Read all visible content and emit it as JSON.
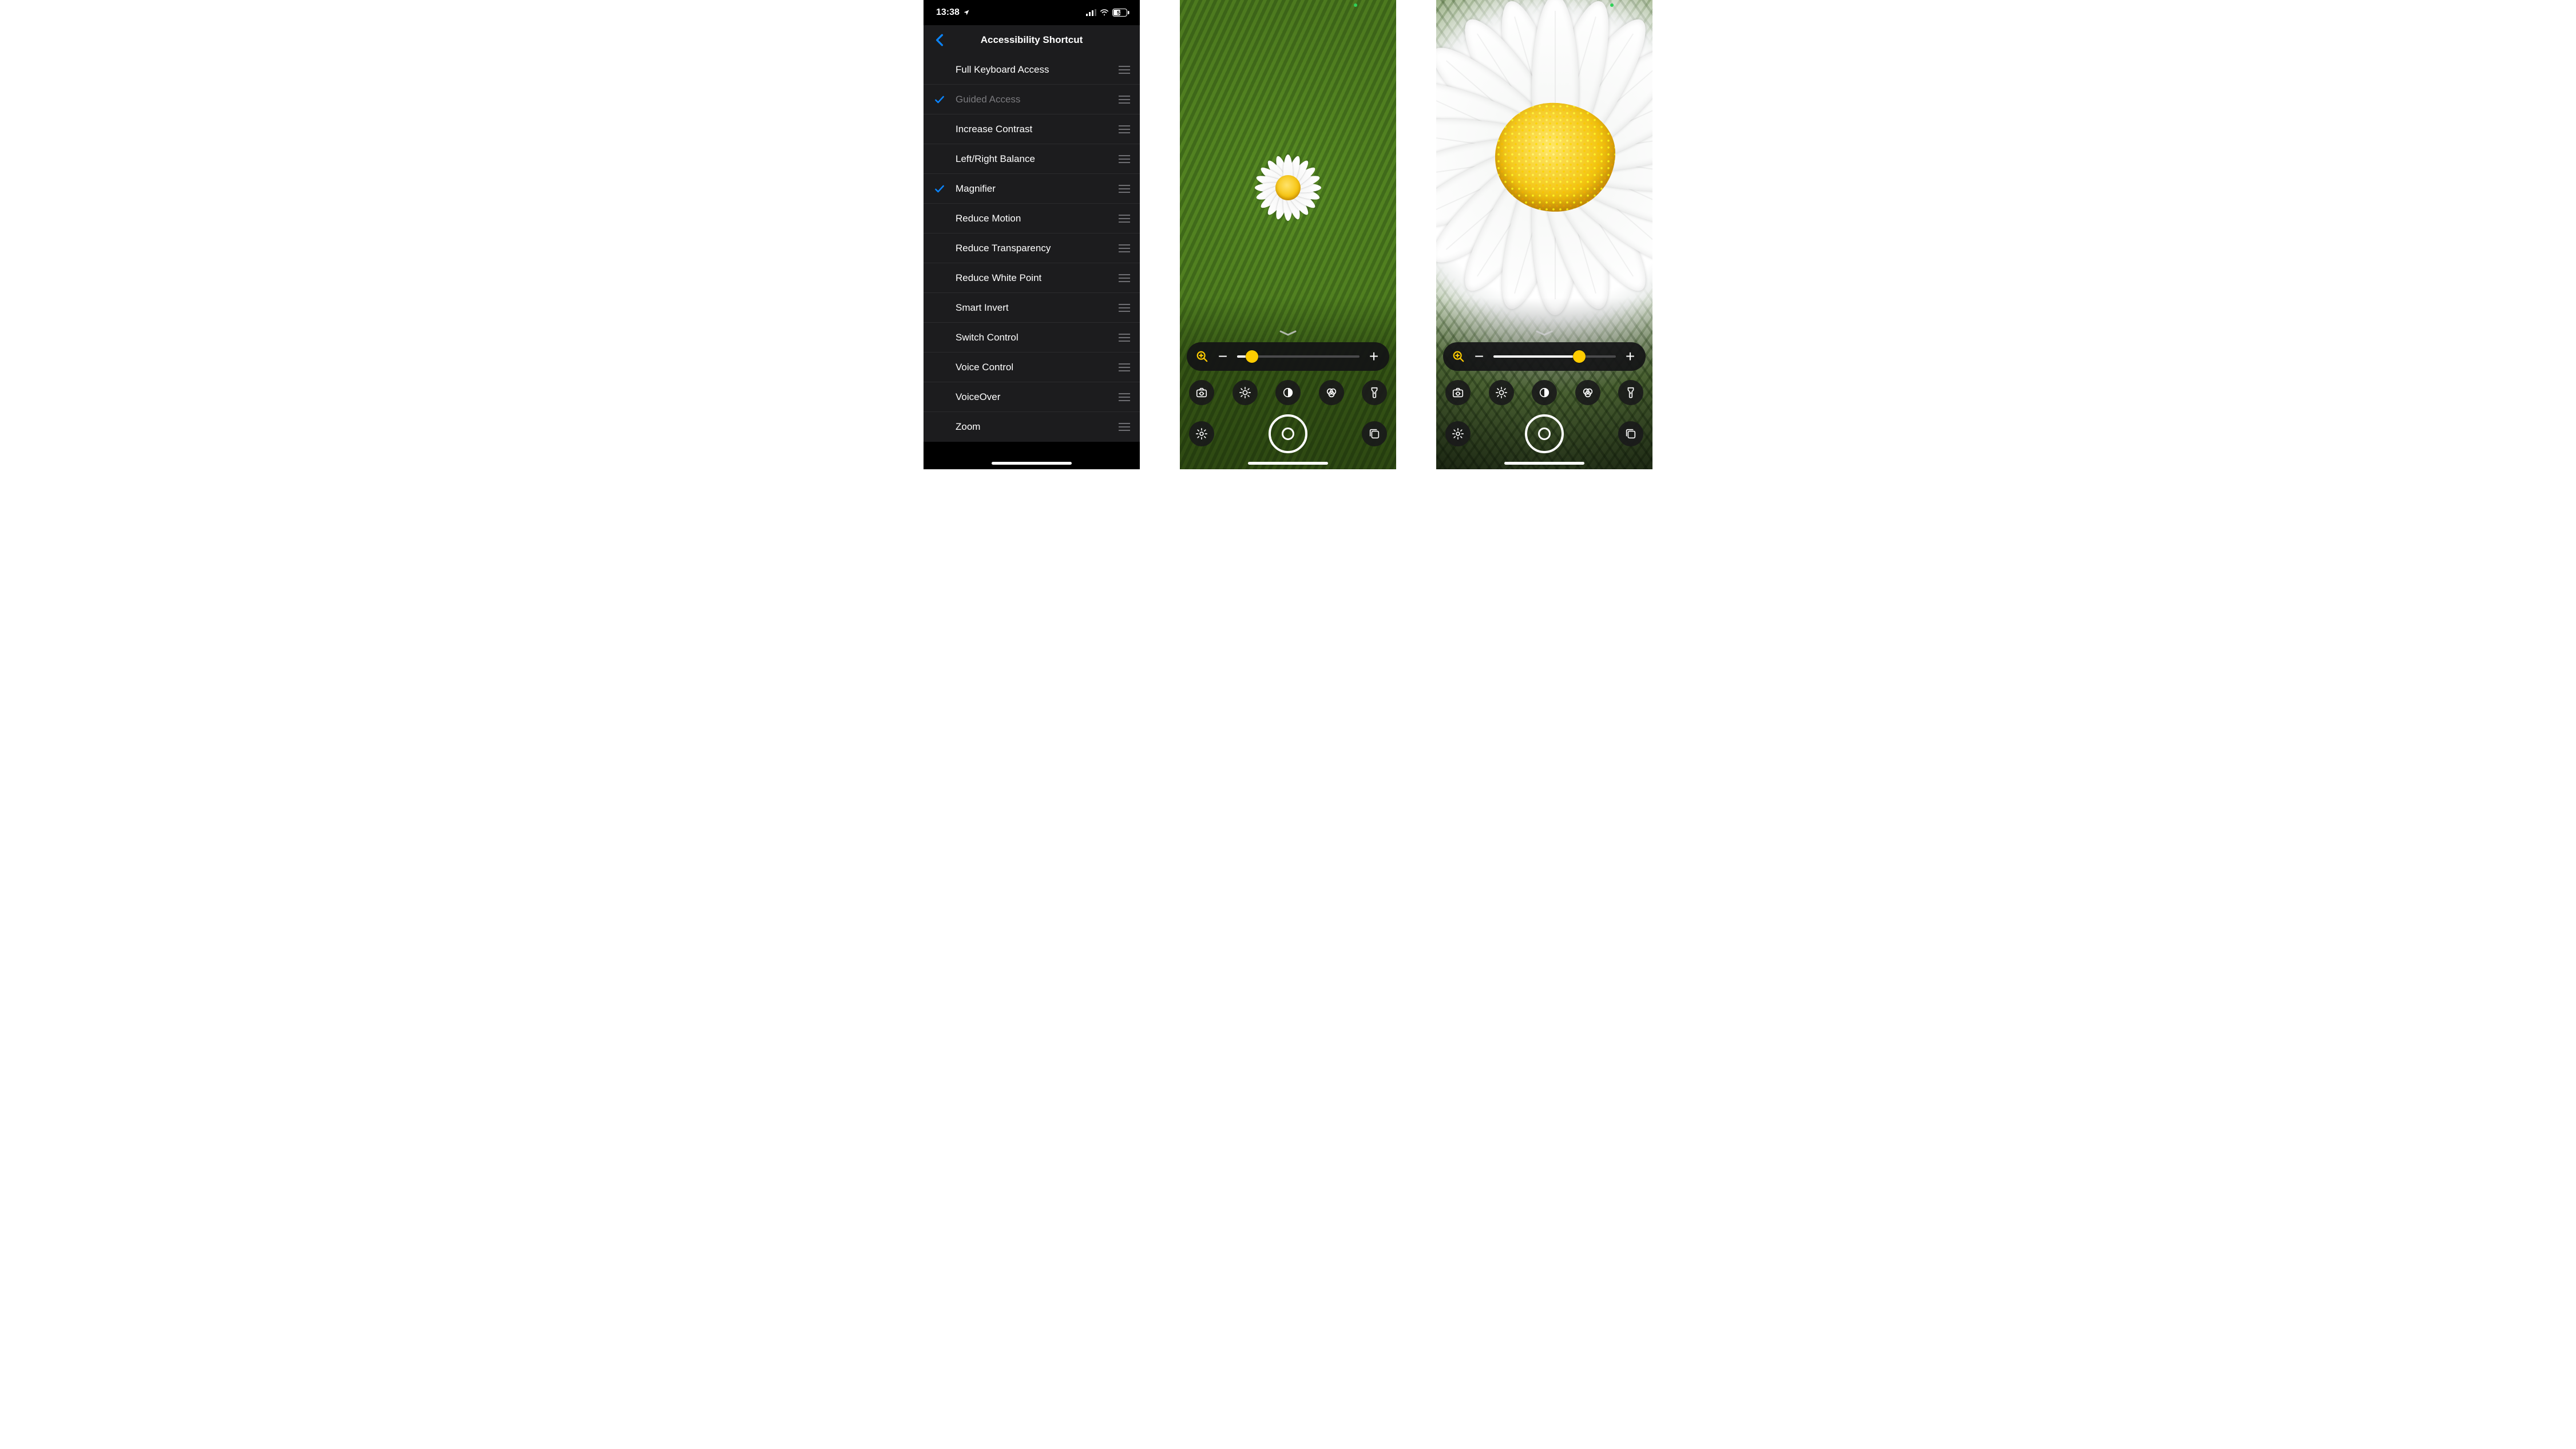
{
  "settings": {
    "status": {
      "time": "13:38",
      "battery": "53"
    },
    "title": "Accessibility Shortcut",
    "rows": [
      {
        "label": "Full Keyboard Access",
        "checked": false,
        "dimmed": false
      },
      {
        "label": "Guided Access",
        "checked": true,
        "dimmed": true
      },
      {
        "label": "Increase Contrast",
        "checked": false,
        "dimmed": false
      },
      {
        "label": "Left/Right Balance",
        "checked": false,
        "dimmed": false
      },
      {
        "label": "Magnifier",
        "checked": true,
        "dimmed": false
      },
      {
        "label": "Reduce Motion",
        "checked": false,
        "dimmed": false
      },
      {
        "label": "Reduce Transparency",
        "checked": false,
        "dimmed": false
      },
      {
        "label": "Reduce White Point",
        "checked": false,
        "dimmed": false
      },
      {
        "label": "Smart Invert",
        "checked": false,
        "dimmed": false
      },
      {
        "label": "Switch Control",
        "checked": false,
        "dimmed": false
      },
      {
        "label": "Voice Control",
        "checked": false,
        "dimmed": false
      },
      {
        "label": "VoiceOver",
        "checked": false,
        "dimmed": false
      },
      {
        "label": "Zoom",
        "checked": false,
        "dimmed": false
      }
    ]
  },
  "magnifier": {
    "accent_color": "#ffcc00",
    "tools": [
      "camera-switch",
      "brightness",
      "contrast",
      "filters",
      "flashlight"
    ],
    "screens": [
      {
        "name": "wide",
        "zoom_percent": 12
      },
      {
        "name": "closeup",
        "zoom_percent": 70
      }
    ]
  }
}
